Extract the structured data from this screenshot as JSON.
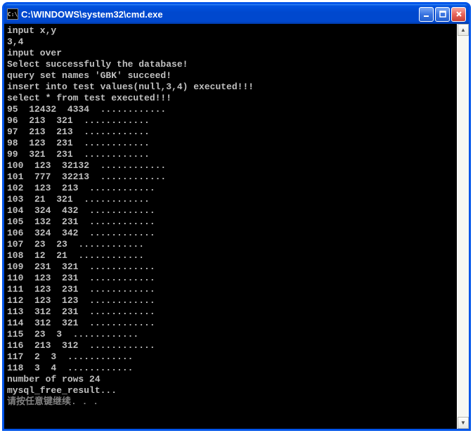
{
  "window": {
    "icon_text": "C:\\",
    "title": "C:\\WINDOWS\\system32\\cmd.exe"
  },
  "console": {
    "lines": [
      "input x,y",
      "3,4",
      "input over",
      "Select successfully the database!",
      "query set names 'GBK' succeed!",
      "insert into test values(null,3,4) executed!!!",
      "select * from test executed!!!",
      "95  12432  4334  ............",
      "96  213  321  ............",
      "97  213  213  ............",
      "98  123  231  ............",
      "99  321  231  ............",
      "100  123  32132  ............",
      "101  777  32213  ............",
      "102  123  213  ............",
      "103  21  321  ............",
      "104  324  432  ............",
      "105  132  231  ............",
      "106  324  342  ............",
      "107  23  23  ............",
      "108  12  21  ............",
      "109  231  321  ............",
      "110  123  231  ............",
      "111  123  231  ............",
      "112  123  123  ............",
      "113  312  231  ............",
      "114  312  321  ............",
      "115  23  3  ............",
      "116  213  312  ............",
      "117  2  3  ............",
      "118  3  4  ............",
      "number of rows 24",
      "mysql_free_result..."
    ],
    "prompt_continue": "请按任意键继续. . ."
  }
}
